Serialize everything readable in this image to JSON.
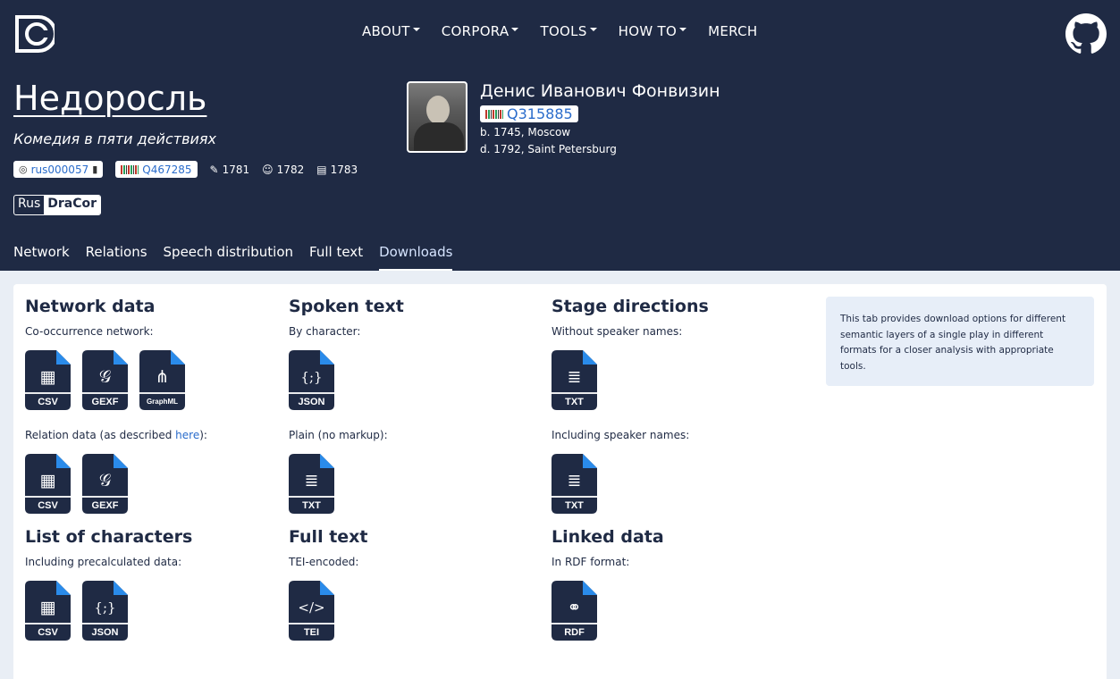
{
  "nav": {
    "items": [
      {
        "label": "ABOUT",
        "dropdown": true
      },
      {
        "label": "CORPORA",
        "dropdown": true
      },
      {
        "label": "TOOLS",
        "dropdown": true
      },
      {
        "label": "HOW TO",
        "dropdown": true
      },
      {
        "label": "MERCH",
        "dropdown": false
      }
    ]
  },
  "play": {
    "title": "Недоросль",
    "subtitle": "Комедия в пяти действиях",
    "id": "rus000057",
    "wikidata": "Q467285",
    "written": "1781",
    "premiered": "1782",
    "printed": "1783",
    "corpus_prefix": "Rus",
    "corpus_suffix": "DraCor"
  },
  "author": {
    "name": "Денис Иванович Фонвизин",
    "wikidata": "Q315885",
    "birth": "b. 1745, Moscow",
    "death": "d. 1792, Saint Petersburg"
  },
  "tabs": [
    {
      "label": "Network",
      "active": false
    },
    {
      "label": "Relations",
      "active": false
    },
    {
      "label": "Speech distribution",
      "active": false
    },
    {
      "label": "Full text",
      "active": false
    },
    {
      "label": "Downloads",
      "active": true
    }
  ],
  "sections": {
    "network": {
      "title": "Network data",
      "label1": "Co-occurrence network:",
      "label2_pre": "Relation data (as described ",
      "label2_link": "here",
      "label2_post": "):"
    },
    "spoken": {
      "title": "Spoken text",
      "label1": "By character:",
      "label2": "Plain (no markup):"
    },
    "stage": {
      "title": "Stage directions",
      "label1": "Without speaker names:",
      "label2": "Including speaker names:"
    },
    "characters": {
      "title": "List of characters",
      "label1": "Including precalculated data:"
    },
    "fulltext": {
      "title": "Full text",
      "label1": "TEI-encoded:"
    },
    "linked": {
      "title": "Linked data",
      "label1": "In RDF format:"
    }
  },
  "file_labels": {
    "csv": "CSV",
    "gexf": "GEXF",
    "graphml": "GraphML",
    "json": "JSON",
    "txt": "TXT",
    "tei": "TEI",
    "rdf": "RDF"
  },
  "info": "This tab provides download options for different semantic layers of a single play in different formats for a closer analysis with appropriate tools.",
  "colors": {
    "header_bg": "#1f2a44",
    "file_icon": "#1f2a44",
    "file_corner": "#2a8bea",
    "link": "#2a6ccb"
  }
}
